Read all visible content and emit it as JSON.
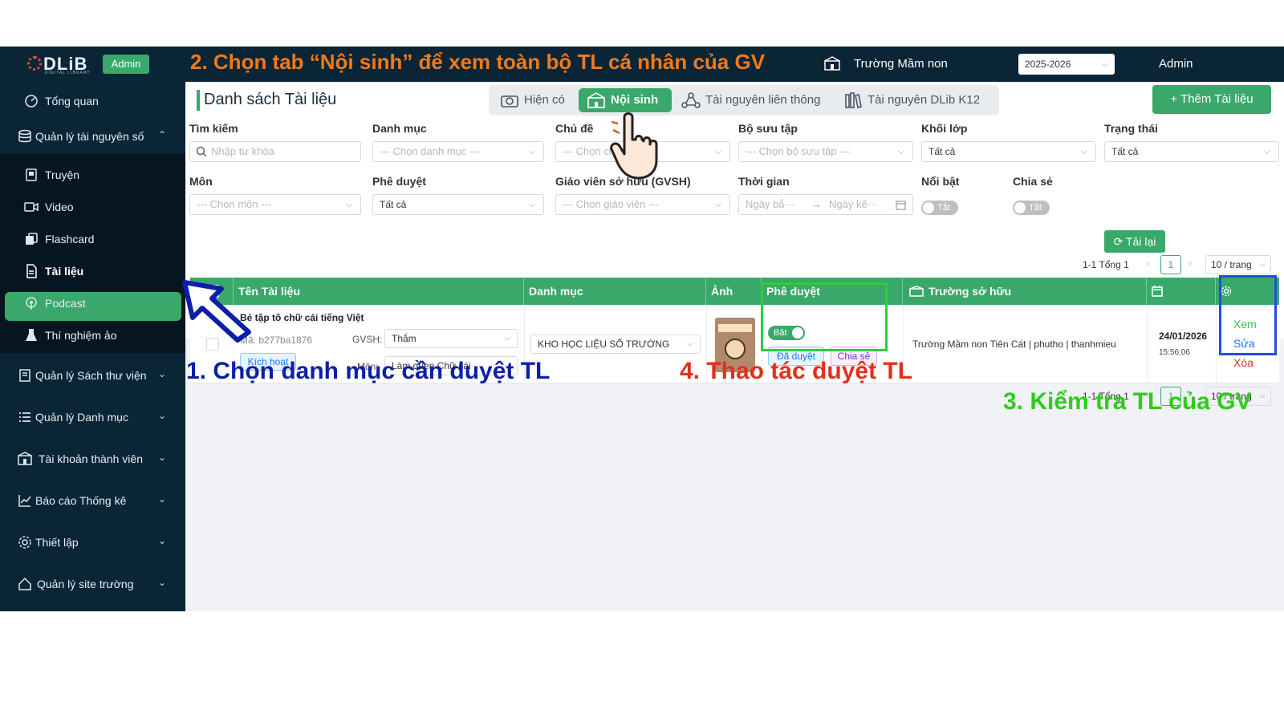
{
  "header": {
    "logo_text": "DLiB",
    "logo_sub": "DIGITAL LIBRARY",
    "role_badge": "Admin",
    "school_name": "Trường Mầm non",
    "school_year": "2025-2026",
    "user": "Admin"
  },
  "sidebar": {
    "items": [
      {
        "label": "Tổng quan",
        "icon": "dashboard-icon"
      },
      {
        "label": "Quản lý tài nguyên số",
        "icon": "database-icon"
      },
      {
        "label": "Truyện",
        "icon": "book-icon"
      },
      {
        "label": "Video",
        "icon": "video-icon"
      },
      {
        "label": "Flashcard",
        "icon": "flashcard-icon"
      },
      {
        "label": "Tài liệu",
        "icon": "document-icon"
      },
      {
        "label": "Podcast",
        "icon": "podcast-icon"
      },
      {
        "label": "Thí nghiệm ảo",
        "icon": "lab-icon"
      },
      {
        "label": "Quản lý Sách thư viện",
        "icon": "library-icon"
      },
      {
        "label": "Quản lý Danh mục",
        "icon": "list-icon"
      },
      {
        "label": "Tài khoản thành viên",
        "icon": "account-icon"
      },
      {
        "label": "Báo cáo Thống kê",
        "icon": "chart-icon"
      },
      {
        "label": "Thiết lập",
        "icon": "gear-icon"
      },
      {
        "label": "Quản lý site trường",
        "icon": "home-icon"
      }
    ]
  },
  "page": {
    "title": "Danh sách Tài liệu",
    "tabs": [
      "Hiện có",
      "Nội sinh",
      "Tài nguyên liên thông",
      "Tài nguyên DLib K12"
    ],
    "active_tab": "Nội sinh",
    "add_button": "+ Thêm Tài liệu"
  },
  "filters": {
    "search": {
      "label": "Tìm kiếm",
      "placeholder": "Nhập từ khóa"
    },
    "category": {
      "label": "Danh mục",
      "placeholder": "--- Chọn danh mục ---"
    },
    "topic": {
      "label": "Chủ đề",
      "placeholder": "--- Chọn chủ đề ---"
    },
    "collection": {
      "label": "Bộ sưu tập",
      "placeholder": "--- Chọn bộ sưu tập ---"
    },
    "grade": {
      "label": "Khối lớp",
      "value": "Tất cả"
    },
    "status": {
      "label": "Trạng thái",
      "value": "Tất cả"
    },
    "subject": {
      "label": "Môn",
      "placeholder": "--- Chọn môn ---"
    },
    "approval": {
      "label": "Phê duyệt",
      "value": "Tất cả"
    },
    "teacher": {
      "label": "Giáo viên sở hữu (GVSH)",
      "placeholder": "--- Chọn giáo viên ---"
    },
    "time": {
      "label": "Thời gian",
      "start_placeholder": "Ngày bắ···",
      "end_placeholder": "Ngày kế···"
    },
    "featured": {
      "label": "Nổi bật",
      "value": "Tắt"
    },
    "share": {
      "label": "Chia sẻ",
      "value": "Tắt"
    },
    "reload": "Tải lại"
  },
  "pagination": {
    "summary": "1-1 Tổng 1",
    "page": "1",
    "page_size": "10 / trang"
  },
  "table": {
    "columns": [
      "Tên Tài liệu",
      "Danh mục",
      "Ảnh",
      "Phê duyệt",
      "Trường sở hữu"
    ],
    "rows": [
      {
        "title": "Bé tập tô chữ cái tiếng Việt",
        "code": "Mã: b277ba1876",
        "gvsh_label": "GVSH:",
        "gvsh_value": "Thắm",
        "subject_label": "Môn:",
        "subject_value": "Làm quen Chữ cái",
        "activate": "Kích hoạt",
        "category": "KHO HỌC LIỆU SỐ TRƯỜNG",
        "approve_toggle": "Bật",
        "approved_tag": "Đã duyệt",
        "share_tag": "Chia sẻ",
        "owner": "Trường Mầm non Tiên Cát | phutho | thanhmieu",
        "date": "24/01/2026",
        "time": "15:56:06",
        "actions": {
          "view": "Xem",
          "edit": "Sửa",
          "delete": "Xóa"
        }
      }
    ]
  },
  "annotations": {
    "step1": "1. Chọn danh mục cần duyệt TL",
    "step2": "2. Chọn tab “Nội sinh” để xem toàn bộ TL cá nhân của GV",
    "step3": "3. Kiểm tra TL của GV",
    "step4": "4. Thao tác duyệt TL",
    "colors": {
      "step1": "#0d1fa8",
      "step2": "#f07a1a",
      "step3": "#2ecc1a",
      "step4": "#e0301e"
    }
  }
}
